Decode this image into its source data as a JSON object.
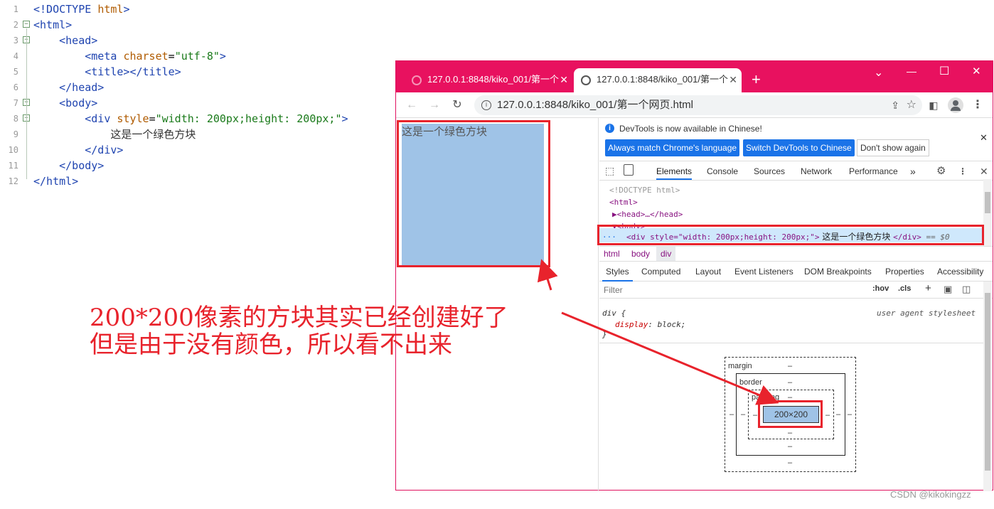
{
  "editor": {
    "lines": [
      {
        "num": "1",
        "html": "<span class='tag'>&lt;!DOCTYPE</span> <span class='attr'>html</span><span class='tag'>&gt;</span>"
      },
      {
        "num": "2",
        "html": "<span class='tag'>&lt;html&gt;</span>"
      },
      {
        "num": "3",
        "html": "    <span class='tag'>&lt;head&gt;</span>"
      },
      {
        "num": "4",
        "html": "        <span class='tag'>&lt;meta</span> <span class='attr'>charset</span>=<span class='str'>\"utf-8\"</span><span class='tag'>&gt;</span>"
      },
      {
        "num": "5",
        "html": "        <span class='tag'>&lt;title&gt;&lt;/title&gt;</span>"
      },
      {
        "num": "6",
        "html": "    <span class='tag'>&lt;/head&gt;</span>"
      },
      {
        "num": "7",
        "html": "    <span class='tag'>&lt;body&gt;</span>"
      },
      {
        "num": "8",
        "html": "        <span class='tag'>&lt;div</span> <span class='attr'>style</span>=<span class='str'>\"width: 200px;height: 200px;\"</span><span class='tag'>&gt;</span>"
      },
      {
        "num": "9",
        "html": "            <span class='txt'>这是一个绿色方块</span>"
      },
      {
        "num": "10",
        "html": "        <span class='tag'>&lt;/div&gt;</span>"
      },
      {
        "num": "11",
        "html": "    <span class='tag'>&lt;/body&gt;</span>"
      },
      {
        "num": "12",
        "html": "<span class='tag'>&lt;/html&gt;</span>"
      }
    ],
    "folds": [
      "2",
      "3",
      "7",
      "8"
    ]
  },
  "browser": {
    "tab1": "127.0.0.1:8848/kiko_001/第一个",
    "tab2": "127.0.0.1:8848/kiko_001/第一个",
    "new_tab": "+",
    "url": "127.0.0.1:8848/kiko_001/第一个网页.html",
    "window_controls": {
      "minimize": "—",
      "maximize": "☐",
      "close": "✕",
      "chevron": "⌄"
    }
  },
  "page": {
    "box_text": "这是一个绿色方块",
    "box_color": "#9fc3e7"
  },
  "devtools": {
    "info": "DevTools is now available in Chinese!",
    "btn_match": "Always match Chrome's language",
    "btn_switch": "Switch DevTools to Chinese",
    "btn_dont": "Don't show again",
    "tabs": [
      "Elements",
      "Console",
      "Sources",
      "Network",
      "Performance"
    ],
    "more": "»",
    "dom": {
      "doctype": "<!DOCTYPE html>",
      "html": "<html>",
      "head": "▶<head>…</head>",
      "body": "▼<body>",
      "selected_pre": "<div style=\"width: 200px;height: 200px;\">",
      "selected_text": " 这是一个绿色方块 ",
      "selected_post": "</div>",
      "selected_eq": " == $0",
      "dots": "..."
    },
    "breadcrumb": [
      "html",
      "body",
      "div"
    ],
    "subtabs": [
      "Styles",
      "Computed",
      "Layout",
      "Event Listeners",
      "DOM Breakpoints",
      "Properties",
      "Accessibility"
    ],
    "filter_placeholder": "Filter",
    "hov": ":hov",
    "cls": ".cls",
    "rule_selector": "div {",
    "rule_source": "user agent stylesheet",
    "rule_prop": "display",
    "rule_value": "block;",
    "rule_close": "}",
    "boxmodel": {
      "margin": "margin",
      "border": "border",
      "padding": "padding",
      "dash": "–",
      "content": "200×200"
    }
  },
  "annotation": {
    "line1": "200*200像素的方块其实已经创建好了",
    "line2": "但是由于没有颜色，所以看不出来"
  },
  "watermark": "CSDN @kikokingzz"
}
